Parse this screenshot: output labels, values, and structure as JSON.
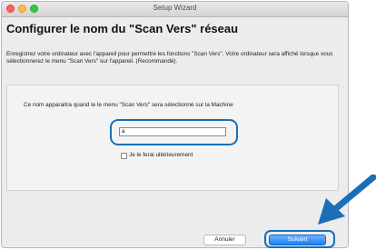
{
  "window": {
    "title": "Setup Wizard"
  },
  "heading": "Configurer le nom du \"Scan Vers\" réseau",
  "intro": "Enregistrez votre ordinateur avec l'appareil pour permettre les fonctions \"Scan Vers\". Votre ordinateur sera affiché lorsque vous sélectionnerez le menu \"Scan Vers\" sur l'appareil. (Recommandé).",
  "panel": {
    "description": "Ce nom apparaitra quand le le menu \"Scan Vers\" sera sélectionné sur la Machine",
    "name_value": "a",
    "later_label": "Je le ferai ultérieurement"
  },
  "buttons": {
    "cancel": "Annuler",
    "next": "Suivant"
  },
  "colors": {
    "callout": "#1a6fb7",
    "primary_button": "#1a82f5"
  }
}
